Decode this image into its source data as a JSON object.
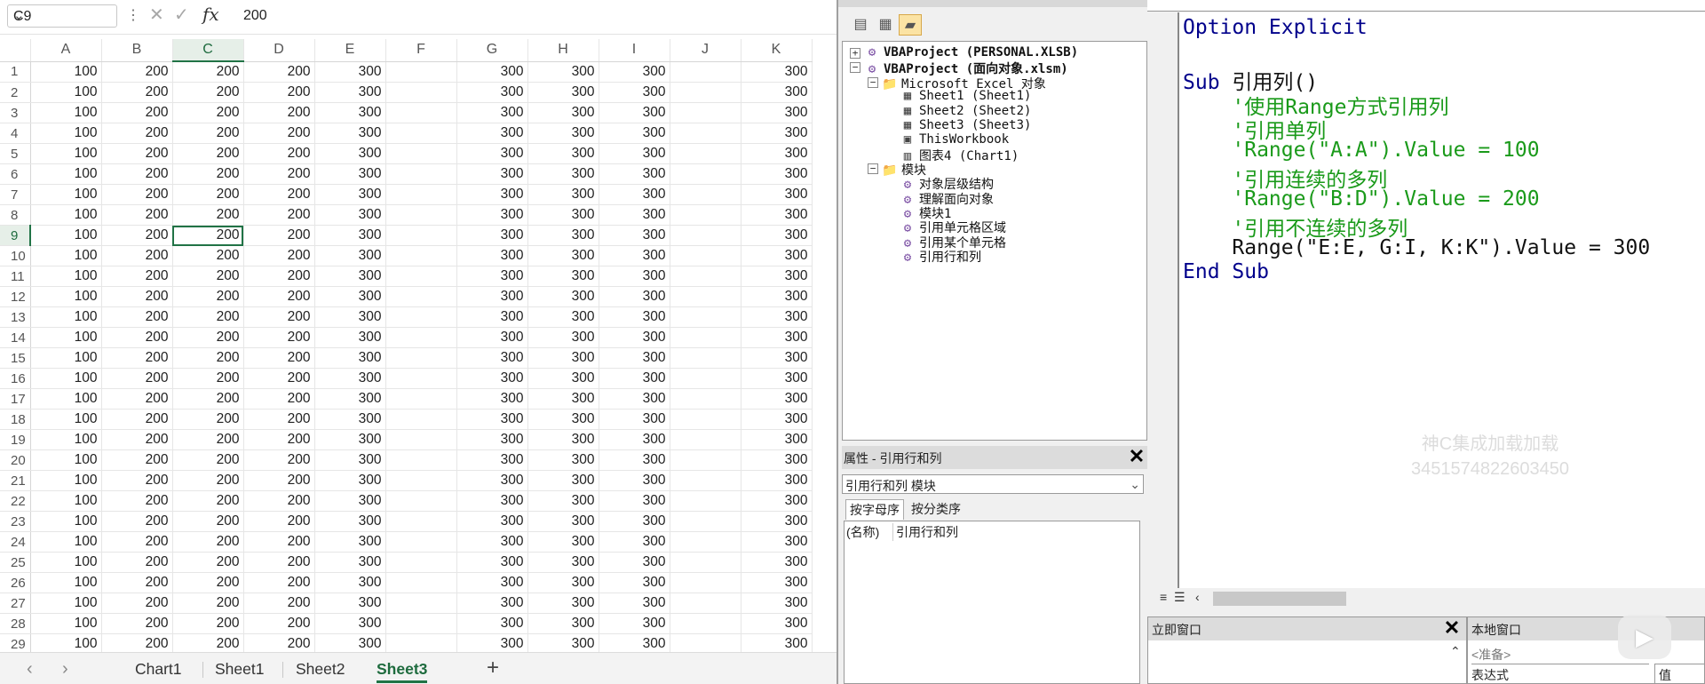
{
  "formula_bar": {
    "name_box": "C9",
    "value": "200",
    "fx_label": "fx",
    "cancel_icon": "✕",
    "enter_icon": "✓"
  },
  "sheet": {
    "columns": [
      "A",
      "B",
      "C",
      "D",
      "E",
      "F",
      "G",
      "H",
      "I",
      "J",
      "K"
    ],
    "selected_column": "C",
    "selected_row": 9,
    "rows": [
      {
        "n": "1",
        "c": [
          "100",
          "200",
          "200",
          "200",
          "300",
          "",
          "300",
          "300",
          "300",
          "",
          "300"
        ]
      },
      {
        "n": "2",
        "c": [
          "100",
          "200",
          "200",
          "200",
          "300",
          "",
          "300",
          "300",
          "300",
          "",
          "300"
        ]
      },
      {
        "n": "3",
        "c": [
          "100",
          "200",
          "200",
          "200",
          "300",
          "",
          "300",
          "300",
          "300",
          "",
          "300"
        ]
      },
      {
        "n": "4",
        "c": [
          "100",
          "200",
          "200",
          "200",
          "300",
          "",
          "300",
          "300",
          "300",
          "",
          "300"
        ]
      },
      {
        "n": "5",
        "c": [
          "100",
          "200",
          "200",
          "200",
          "300",
          "",
          "300",
          "300",
          "300",
          "",
          "300"
        ]
      },
      {
        "n": "6",
        "c": [
          "100",
          "200",
          "200",
          "200",
          "300",
          "",
          "300",
          "300",
          "300",
          "",
          "300"
        ]
      },
      {
        "n": "7",
        "c": [
          "100",
          "200",
          "200",
          "200",
          "300",
          "",
          "300",
          "300",
          "300",
          "",
          "300"
        ]
      },
      {
        "n": "8",
        "c": [
          "100",
          "200",
          "200",
          "200",
          "300",
          "",
          "300",
          "300",
          "300",
          "",
          "300"
        ]
      },
      {
        "n": "9",
        "c": [
          "100",
          "200",
          "200",
          "200",
          "300",
          "",
          "300",
          "300",
          "300",
          "",
          "300"
        ]
      },
      {
        "n": "10",
        "c": [
          "100",
          "200",
          "200",
          "200",
          "300",
          "",
          "300",
          "300",
          "300",
          "",
          "300"
        ]
      },
      {
        "n": "11",
        "c": [
          "100",
          "200",
          "200",
          "200",
          "300",
          "",
          "300",
          "300",
          "300",
          "",
          "300"
        ]
      },
      {
        "n": "12",
        "c": [
          "100",
          "200",
          "200",
          "200",
          "300",
          "",
          "300",
          "300",
          "300",
          "",
          "300"
        ]
      },
      {
        "n": "13",
        "c": [
          "100",
          "200",
          "200",
          "200",
          "300",
          "",
          "300",
          "300",
          "300",
          "",
          "300"
        ]
      },
      {
        "n": "14",
        "c": [
          "100",
          "200",
          "200",
          "200",
          "300",
          "",
          "300",
          "300",
          "300",
          "",
          "300"
        ]
      },
      {
        "n": "15",
        "c": [
          "100",
          "200",
          "200",
          "200",
          "300",
          "",
          "300",
          "300",
          "300",
          "",
          "300"
        ]
      },
      {
        "n": "16",
        "c": [
          "100",
          "200",
          "200",
          "200",
          "300",
          "",
          "300",
          "300",
          "300",
          "",
          "300"
        ]
      },
      {
        "n": "17",
        "c": [
          "100",
          "200",
          "200",
          "200",
          "300",
          "",
          "300",
          "300",
          "300",
          "",
          "300"
        ]
      },
      {
        "n": "18",
        "c": [
          "100",
          "200",
          "200",
          "200",
          "300",
          "",
          "300",
          "300",
          "300",
          "",
          "300"
        ]
      },
      {
        "n": "19",
        "c": [
          "100",
          "200",
          "200",
          "200",
          "300",
          "",
          "300",
          "300",
          "300",
          "",
          "300"
        ]
      },
      {
        "n": "20",
        "c": [
          "100",
          "200",
          "200",
          "200",
          "300",
          "",
          "300",
          "300",
          "300",
          "",
          "300"
        ]
      },
      {
        "n": "21",
        "c": [
          "100",
          "200",
          "200",
          "200",
          "300",
          "",
          "300",
          "300",
          "300",
          "",
          "300"
        ]
      },
      {
        "n": "22",
        "c": [
          "100",
          "200",
          "200",
          "200",
          "300",
          "",
          "300",
          "300",
          "300",
          "",
          "300"
        ]
      },
      {
        "n": "23",
        "c": [
          "100",
          "200",
          "200",
          "200",
          "300",
          "",
          "300",
          "300",
          "300",
          "",
          "300"
        ]
      },
      {
        "n": "24",
        "c": [
          "100",
          "200",
          "200",
          "200",
          "300",
          "",
          "300",
          "300",
          "300",
          "",
          "300"
        ]
      },
      {
        "n": "25",
        "c": [
          "100",
          "200",
          "200",
          "200",
          "300",
          "",
          "300",
          "300",
          "300",
          "",
          "300"
        ]
      },
      {
        "n": "26",
        "c": [
          "100",
          "200",
          "200",
          "200",
          "300",
          "",
          "300",
          "300",
          "300",
          "",
          "300"
        ]
      },
      {
        "n": "27",
        "c": [
          "100",
          "200",
          "200",
          "200",
          "300",
          "",
          "300",
          "300",
          "300",
          "",
          "300"
        ]
      },
      {
        "n": "28",
        "c": [
          "100",
          "200",
          "200",
          "200",
          "300",
          "",
          "300",
          "300",
          "300",
          "",
          "300"
        ]
      },
      {
        "n": "29",
        "c": [
          "100",
          "200",
          "200",
          "200",
          "300",
          "",
          "300",
          "300",
          "300",
          "",
          "300"
        ]
      }
    ]
  },
  "sheet_tabs": {
    "prev": "‹",
    "next": "›",
    "tabs": [
      "Chart1",
      "Sheet1",
      "Sheet2",
      "Sheet3"
    ],
    "active": "Sheet3",
    "add": "+"
  },
  "project_explorer": {
    "items": [
      {
        "label": "VBAProject (PERSONAL.XLSB)"
      },
      {
        "label": "VBAProject (面向对象.xlsm)"
      },
      {
        "label": "Microsoft Excel 对象"
      },
      {
        "label": "Sheet1 (Sheet1)"
      },
      {
        "label": "Sheet2 (Sheet2)"
      },
      {
        "label": "Sheet3 (Sheet3)"
      },
      {
        "label": "ThisWorkbook"
      },
      {
        "label": "图表4 (Chart1)"
      },
      {
        "label": "模块"
      },
      {
        "label": "对象层级结构"
      },
      {
        "label": "理解面向对象"
      },
      {
        "label": "模块1"
      },
      {
        "label": "引用单元格区域"
      },
      {
        "label": "引用某个单元格"
      },
      {
        "label": "引用行和列"
      }
    ]
  },
  "properties": {
    "title": "属性 - 引用行和列",
    "combo": "引用行和列 模块",
    "tab_alpha": "按字母序",
    "tab_category": "按分类序",
    "name_key": "(名称)",
    "name_value": "引用行和列"
  },
  "code": {
    "lines": [
      "Option Explicit",
      "",
      "Sub 引用列()",
      "    '使用Range方式引用列",
      "    '引用单列",
      "    'Range(\"A:A\").Value = 100",
      "    '引用连续的多列",
      "    'Range(\"B:D\").Value = 200",
      "    '引用不连续的多列",
      "    Range(\"E:E, G:I, K:K\").Value = 300",
      "End Sub"
    ]
  },
  "immediate": {
    "title": "立即窗口"
  },
  "locals": {
    "title": "本地窗口",
    "status": "<准备>",
    "col_expr": "表达式",
    "col_value": "值"
  },
  "watermark": {
    "line1": "神C集成加载加载",
    "line2": "3451574822603450"
  },
  "colors": {
    "excel_green": "#217346",
    "vba_keyword": "#00008b",
    "vba_comment": "#1a9a1a"
  }
}
